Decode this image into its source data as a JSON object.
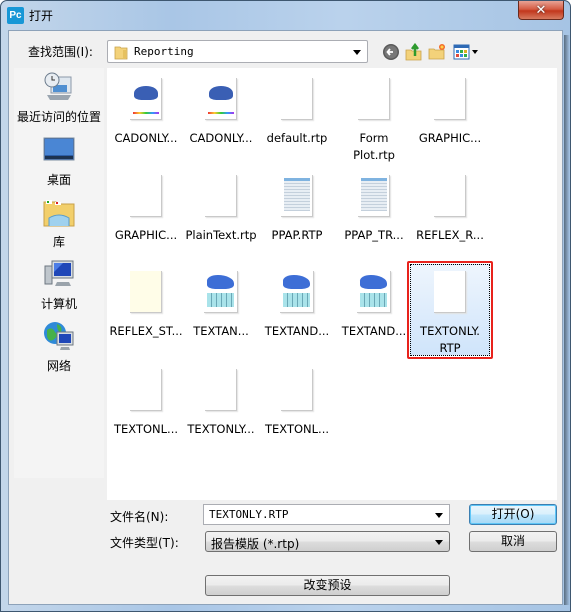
{
  "window": {
    "app_icon": "Pc",
    "title": "打开",
    "close_glyph": "✕"
  },
  "toolbar": {
    "lookin_label": "查找范围(I):",
    "lookin_value": "Reporting",
    "icons": [
      "back-icon",
      "up-folder-icon",
      "new-folder-icon",
      "view-menu-icon"
    ]
  },
  "places": [
    {
      "label": "最近访问的位置",
      "icon": "recent-places-icon"
    },
    {
      "label": "桌面",
      "icon": "desktop-icon"
    },
    {
      "label": "库",
      "icon": "libraries-icon"
    },
    {
      "label": "计算机",
      "icon": "computer-icon"
    },
    {
      "label": "网络",
      "icon": "network-icon"
    }
  ],
  "files": [
    {
      "name": "CADONLY...",
      "thumb": "cad"
    },
    {
      "name": "CADONLY...",
      "thumb": "cad"
    },
    {
      "name": "default.rtp",
      "thumb": "blank"
    },
    {
      "name": "Form\nPlot.rtp",
      "thumb": "blank"
    },
    {
      "name": "GRAPHIC...",
      "thumb": "blank"
    },
    {
      "name": "GRAPHIC...",
      "thumb": "blank"
    },
    {
      "name": "PlainText.rtp",
      "thumb": "blank"
    },
    {
      "name": "PPAP.RTP",
      "thumb": "table"
    },
    {
      "name": "PPAP_TR...",
      "thumb": "table"
    },
    {
      "name": "REFLEX_R...",
      "thumb": "blank"
    },
    {
      "name": "REFLEX_ST...",
      "thumb": "cream"
    },
    {
      "name": "TEXTAN...",
      "thumb": "textand"
    },
    {
      "name": "TEXTAND...",
      "thumb": "textand"
    },
    {
      "name": "TEXTAND...",
      "thumb": "textand"
    },
    {
      "name": "TEXTONLY.\nRTP",
      "thumb": "blank",
      "selected": true
    },
    {
      "name": "TEXTONL...",
      "thumb": "blank"
    },
    {
      "name": "TEXTONLY...",
      "thumb": "blank"
    },
    {
      "name": "TEXTONL...",
      "thumb": "blank"
    }
  ],
  "form": {
    "filename_label": "文件名(N):",
    "filename_value": "TEXTONLY.RTP",
    "filetype_label": "文件类型(T):",
    "filetype_value": "报告模版 (*.rtp)",
    "open_button": "打开(O)",
    "cancel_button": "取消",
    "preset_button": "改变预设"
  },
  "colors": {
    "selection_highlight": "#e8221c",
    "app_icon_bg": "#1797d6"
  }
}
